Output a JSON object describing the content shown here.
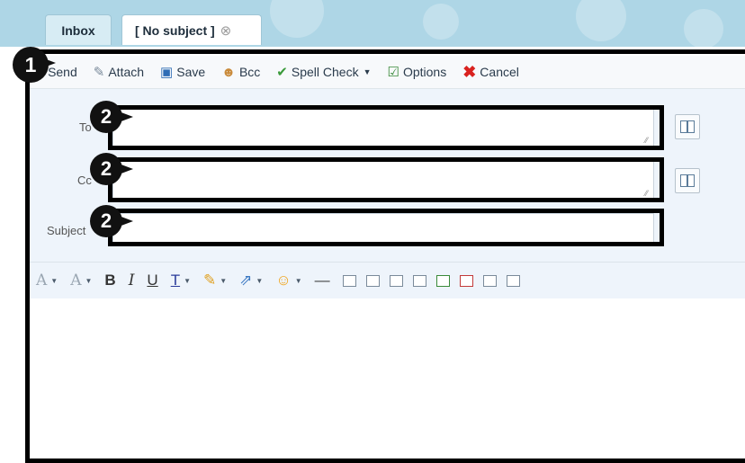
{
  "tabs": [
    {
      "label": "Inbox"
    },
    {
      "label": "[ No subject ]"
    }
  ],
  "toolbar": {
    "send": "Send",
    "attach": "Attach",
    "save": "Save",
    "bcc": "Bcc",
    "spell_check": "Spell Check",
    "options": "Options",
    "cancel": "Cancel"
  },
  "form": {
    "to_label": "To",
    "cc_label": "Cc",
    "subject_label": "Subject"
  },
  "formatting": {
    "bold": "B",
    "italic": "I",
    "underline": "U"
  },
  "annotations": {
    "marker_1": "1",
    "marker_2": "2"
  },
  "colors": {
    "tab_bar": "#aed6e6",
    "form_background": "#eef4fb",
    "cancel_red": "#d9221f",
    "annotation": "#000000"
  }
}
